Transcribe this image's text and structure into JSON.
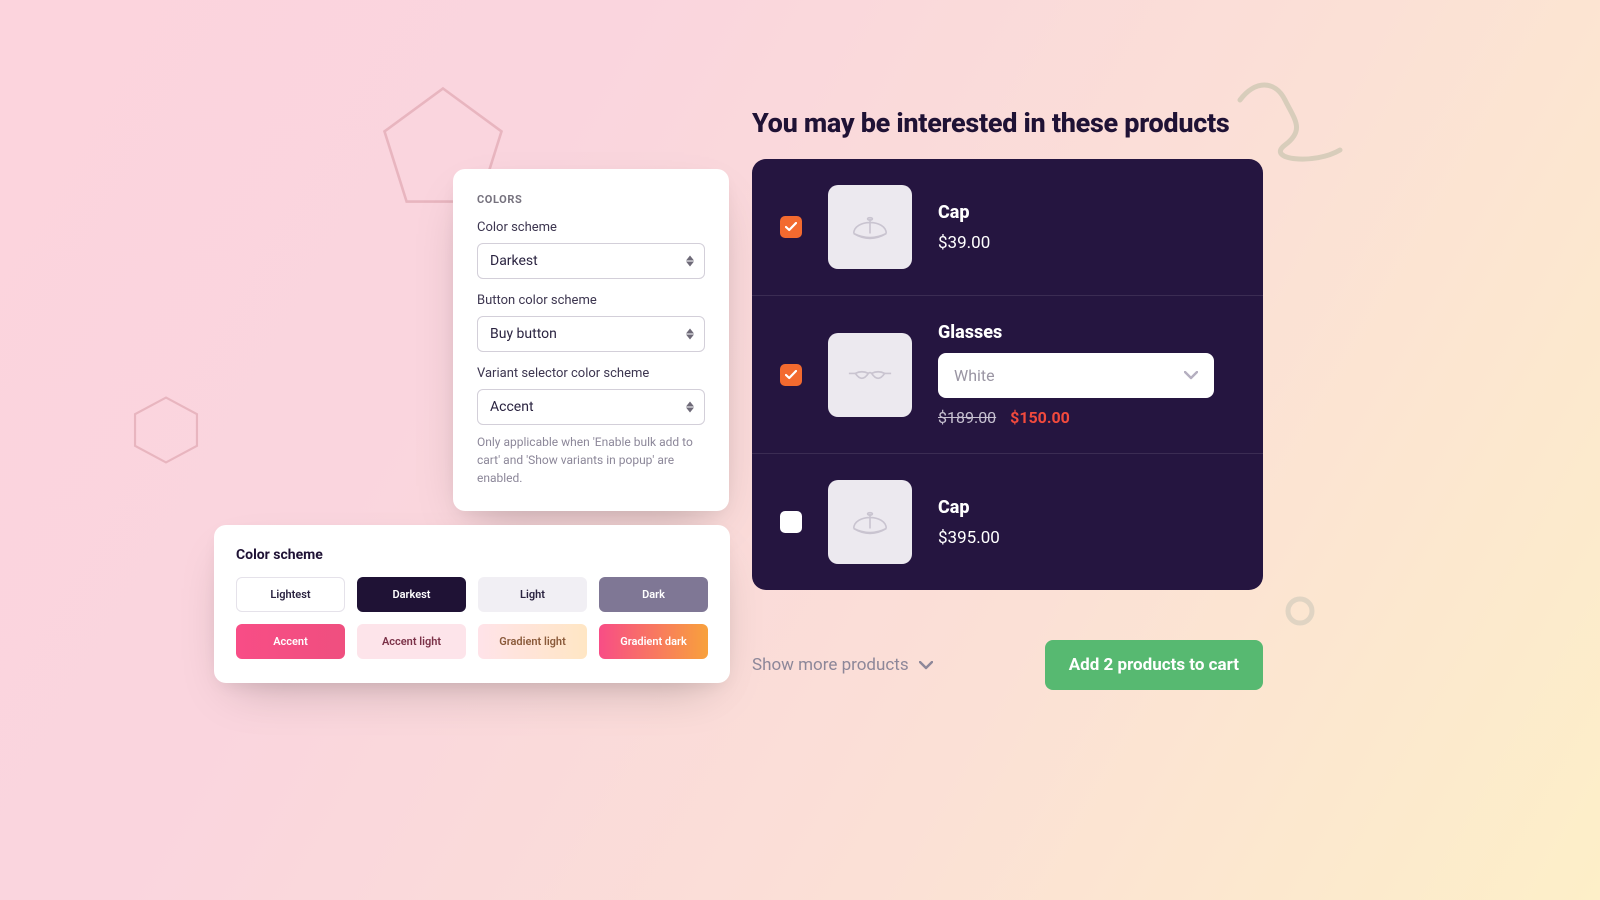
{
  "settings": {
    "heading": "COLORS",
    "color_scheme": {
      "label": "Color scheme",
      "value": "Darkest"
    },
    "button_color_scheme": {
      "label": "Button color scheme",
      "value": "Buy button"
    },
    "variant_selector_scheme": {
      "label": "Variant selector color scheme",
      "value": "Accent",
      "helper": "Only applicable when 'Enable bulk add to cart' and 'Show variants in popup' are enabled."
    }
  },
  "palette": {
    "title": "Color scheme",
    "swatches": [
      {
        "label": "Lightest"
      },
      {
        "label": "Darkest"
      },
      {
        "label": "Light"
      },
      {
        "label": "Dark"
      },
      {
        "label": "Accent"
      },
      {
        "label": "Accent light"
      },
      {
        "label": "Gradient light"
      },
      {
        "label": "Gradient dark"
      }
    ]
  },
  "upsell": {
    "title": "You may be interested in these products",
    "products": [
      {
        "name": "Cap",
        "price": "$39.00",
        "checked": true,
        "icon": "cap"
      },
      {
        "name": "Glasses",
        "variant": "White",
        "compare": "$189.00",
        "price": "$150.00",
        "checked": true,
        "icon": "glasses"
      },
      {
        "name": "Cap",
        "price": "$395.00",
        "checked": false,
        "icon": "cap"
      }
    ],
    "show_more": "Show more products",
    "cta": "Add 2 products to cart"
  }
}
